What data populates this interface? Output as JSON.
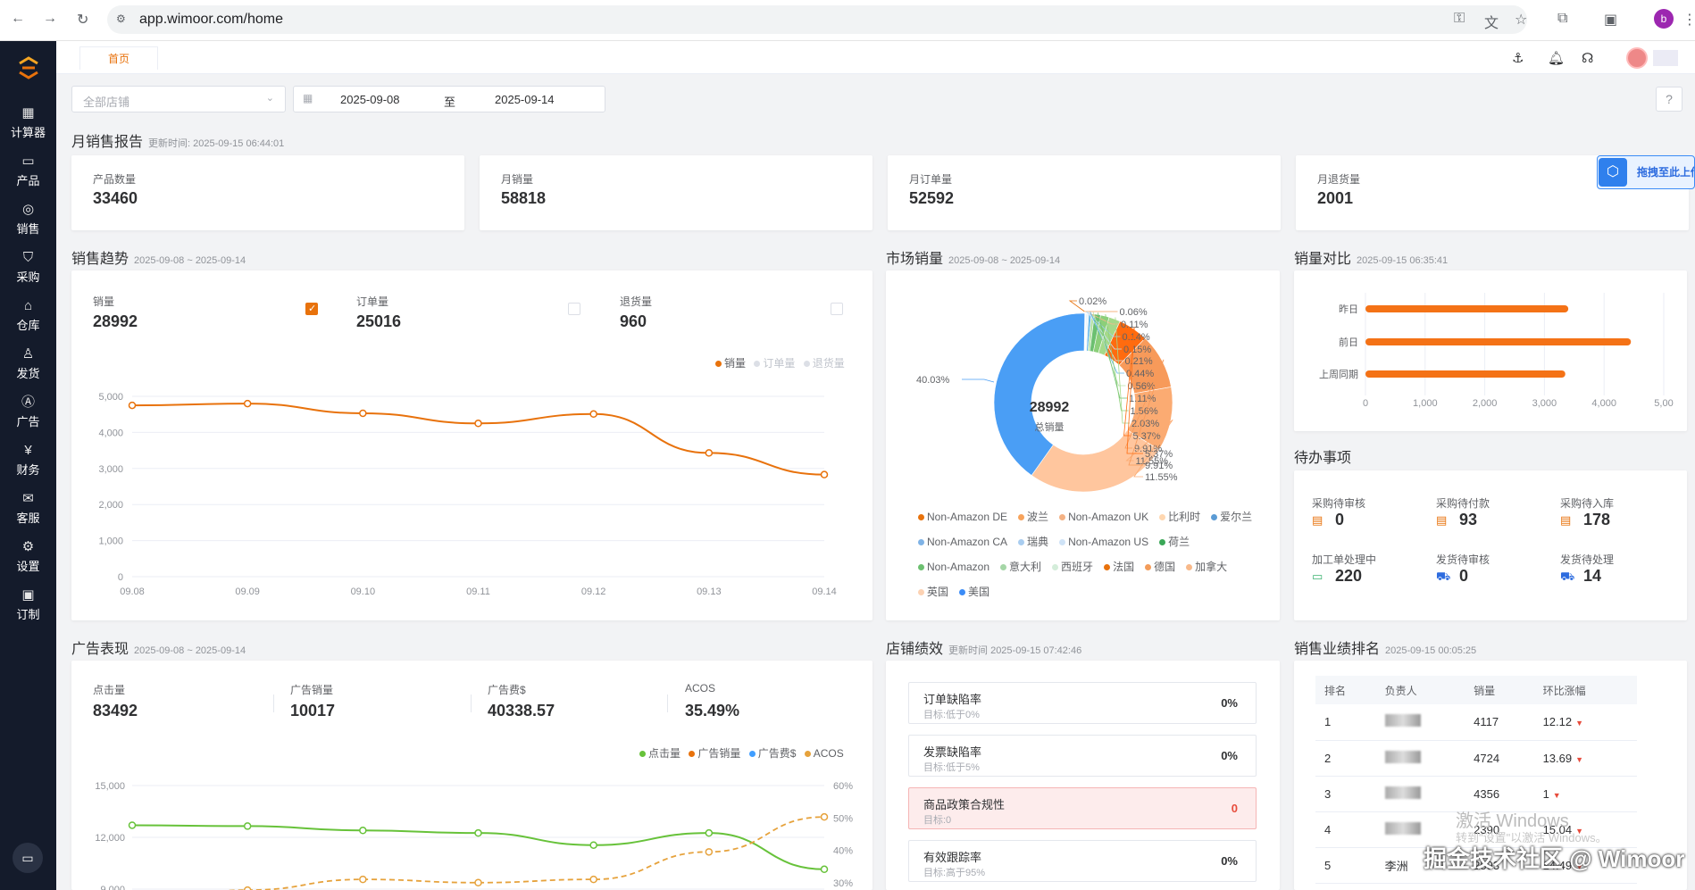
{
  "browser": {
    "url": "app.wimoor.com/home",
    "profile": "b"
  },
  "sidebar": {
    "items": [
      {
        "label": "计算器",
        "icon": "calculator-icon",
        "glyph": "▦"
      },
      {
        "label": "产品",
        "icon": "box-icon",
        "glyph": "▭"
      },
      {
        "label": "销售",
        "icon": "sales-icon",
        "glyph": "◎"
      },
      {
        "label": "采购",
        "icon": "bag-icon",
        "glyph": "⛉"
      },
      {
        "label": "仓库",
        "icon": "warehouse-icon",
        "glyph": "⌂"
      },
      {
        "label": "发货",
        "icon": "ship-icon",
        "glyph": "♙"
      },
      {
        "label": "广告",
        "icon": "ad-icon",
        "glyph": "Ⓐ"
      },
      {
        "label": "财务",
        "icon": "finance-icon",
        "glyph": "¥"
      },
      {
        "label": "客服",
        "icon": "mail-icon",
        "glyph": "✉"
      },
      {
        "label": "设置",
        "icon": "gear-icon",
        "glyph": "⚙"
      },
      {
        "label": "订制",
        "icon": "custom-icon",
        "glyph": "▣"
      }
    ]
  },
  "tabs": {
    "home": "首页"
  },
  "filters": {
    "shop_placeholder": "全部店铺",
    "date_from": "2025-09-08",
    "date_sep": "至",
    "date_to": "2025-09-14"
  },
  "monthly": {
    "title": "月销售报告",
    "updated": "更新时间: 2025-09-15 06:44:01",
    "cards": [
      {
        "label": "产品数量",
        "value": "33460"
      },
      {
        "label": "月销量",
        "value": "58818"
      },
      {
        "label": "月订单量",
        "value": "52592"
      },
      {
        "label": "月退货量",
        "value": "2001"
      }
    ]
  },
  "drag_btn": "拖拽至此上传",
  "trend": {
    "title": "销售趋势",
    "range": "2025-09-08 ~ 2025-09-14",
    "stats": [
      {
        "label": "销量",
        "value": "28992",
        "checked": true
      },
      {
        "label": "订单量",
        "value": "25016",
        "checked": false
      },
      {
        "label": "退货量",
        "value": "960",
        "checked": false
      }
    ],
    "legend": [
      {
        "name": "销量",
        "color": "#e8720c",
        "active": true
      },
      {
        "name": "订单量",
        "color": "#c0c4cc",
        "active": false
      },
      {
        "name": "退货量",
        "color": "#c0c4cc",
        "active": false
      }
    ]
  },
  "market": {
    "title": "市场销量",
    "range": "2025-09-08 ~ 2025-09-14",
    "center_value": "28992",
    "center_label": "总销量",
    "left_label": "40.03%",
    "overlap_label": "25.70%",
    "legend": [
      {
        "name": "Non-Amazon DE",
        "color": "#e8720c"
      },
      {
        "name": "波兰",
        "color": "#f7a35c"
      },
      {
        "name": "Non-Amazon UK",
        "color": "#f4b183"
      },
      {
        "name": "比利时",
        "color": "#ffd7b0"
      },
      {
        "name": "爱尔兰",
        "color": "#5b9bd5"
      },
      {
        "name": "Non-Amazon CA",
        "color": "#7fb3e6"
      },
      {
        "name": "瑞典",
        "color": "#a9cdf0"
      },
      {
        "name": "Non-Amazon US",
        "color": "#cfe3f7"
      },
      {
        "name": "荷兰",
        "color": "#3aa757"
      },
      {
        "name": "Non-Amazon",
        "color": "#6cc070"
      },
      {
        "name": "意大利",
        "color": "#a5d6a7"
      },
      {
        "name": "西班牙",
        "color": "#d4edda"
      },
      {
        "name": "法国",
        "color": "#e8720c"
      },
      {
        "name": "德国",
        "color": "#f39c5a"
      },
      {
        "name": "加拿大",
        "color": "#f8b98a"
      },
      {
        "name": "英国",
        "color": "#fcd2b3"
      },
      {
        "name": "美国",
        "color": "#3b8cf7"
      }
    ]
  },
  "compare": {
    "title": "销量对比",
    "updated": "2025-09-15 06:35:41"
  },
  "todo": {
    "title": "待办事项",
    "items": [
      {
        "label": "采购待审核",
        "value": "0",
        "icon": "document-icon",
        "glyph": "▤",
        "tone": ""
      },
      {
        "label": "采购待付款",
        "value": "93",
        "icon": "document-icon",
        "glyph": "▤",
        "tone": ""
      },
      {
        "label": "采购待入库",
        "value": "178",
        "icon": "document-icon",
        "glyph": "▤",
        "tone": ""
      },
      {
        "label": "加工单处理中",
        "value": "220",
        "icon": "monitor-icon",
        "glyph": "▭",
        "tone": "g"
      },
      {
        "label": "发货待审核",
        "value": "0",
        "icon": "truck-icon",
        "glyph": "⛟",
        "tone": "b"
      },
      {
        "label": "发货待处理",
        "value": "14",
        "icon": "truck-icon",
        "glyph": "⛟",
        "tone": "b"
      }
    ]
  },
  "ads": {
    "title": "广告表现",
    "range": "2025-09-08 ~ 2025-09-14",
    "stats": [
      {
        "label": "点击量",
        "value": "83492"
      },
      {
        "label": "广告销量",
        "value": "10017"
      },
      {
        "label": "广告费$",
        "value": "40338.57"
      },
      {
        "label": "ACOS",
        "value": "35.49%"
      }
    ],
    "legend": [
      {
        "name": "点击量",
        "color": "#67c23a"
      },
      {
        "name": "广告销量",
        "color": "#e8720c"
      },
      {
        "name": "广告费$",
        "color": "#409eff"
      },
      {
        "name": "ACOS",
        "color": "#e6a23c"
      }
    ]
  },
  "shop": {
    "title": "店铺绩效",
    "updated": "更新时间 2025-09-15 07:42:46",
    "items": [
      {
        "name": "订单缺陷率",
        "target": "目标:低于0%",
        "value": "0%",
        "alert": false
      },
      {
        "name": "发票缺陷率",
        "target": "目标:低于5%",
        "value": "0%",
        "alert": false
      },
      {
        "name": "商品政策合规性",
        "target": "目标:0",
        "value": "0",
        "alert": true
      },
      {
        "name": "有效跟踪率",
        "target": "目标:高于95%",
        "value": "0%",
        "alert": false
      }
    ]
  },
  "rank": {
    "title": "销售业绩排名",
    "updated": "2025-09-15 00:05:25",
    "headers": [
      "排名",
      "负责人",
      "销量",
      "环比涨幅"
    ],
    "rows": [
      {
        "rank": "1",
        "name": "",
        "sales": "4117",
        "mom": "12.12"
      },
      {
        "rank": "2",
        "name": "",
        "sales": "4724",
        "mom": "13.69"
      },
      {
        "rank": "3",
        "name": "",
        "sales": "4356",
        "mom": "1"
      },
      {
        "rank": "4",
        "name": "",
        "sales": "2390",
        "mom": "15.04"
      },
      {
        "rank": "5",
        "name": "李洲",
        "sales": "2593",
        "mom": "14.49"
      }
    ]
  },
  "watermarks": {
    "windows1": "激活 Windows",
    "windows2": "转到\"设置\"以激活 Windows。",
    "juejin": "掘金技术社区 @ Wimoor"
  },
  "chart_data": [
    {
      "type": "line",
      "title": "销售趋势",
      "x": [
        "09.08",
        "09.09",
        "09.10",
        "09.11",
        "09.12",
        "09.13",
        "09.14"
      ],
      "series": [
        {
          "name": "销量",
          "values": [
            4750,
            4800,
            4530,
            4250,
            4510,
            3430,
            2830
          ]
        }
      ],
      "ylim": [
        0,
        5000
      ],
      "yticks": [
        0,
        1000,
        2000,
        3000,
        4000,
        5000
      ],
      "ytick_labels": [
        "0",
        "1,000",
        "2,000",
        "3,000",
        "4,000",
        "5,000"
      ],
      "grid": true,
      "legend": "top-right"
    },
    {
      "type": "pie",
      "title": "市场销量",
      "slices": [
        {
          "label": "40.03%",
          "value": 40.03,
          "color": "#4a9ef5"
        },
        {
          "label": "25.70%",
          "value": 25.7,
          "color": "#ffc69e"
        },
        {
          "label": "11.55%",
          "value": 11.55,
          "color": "#fbab72"
        },
        {
          "label": "9.91%",
          "value": 9.91,
          "color": "#f79a5a"
        },
        {
          "label": "5.37%",
          "value": 5.37,
          "color": "#ff6b0f"
        },
        {
          "label": "2.03%",
          "value": 2.03,
          "color": "#a5d98a"
        },
        {
          "label": "1.56%",
          "value": 1.56,
          "color": "#8ccf7a"
        },
        {
          "label": "1.11%",
          "value": 1.11,
          "color": "#6cc070"
        },
        {
          "label": "0.56%",
          "value": 0.56,
          "color": "#b7e1a8"
        },
        {
          "label": "0.44%",
          "value": 0.44,
          "color": "#5fb3e6"
        },
        {
          "label": "0.21%",
          "value": 0.21,
          "color": "#d3e9f7"
        },
        {
          "label": "0.15%",
          "value": 0.15,
          "color": "#c6e2f6"
        },
        {
          "label": "0.14%",
          "value": 0.14,
          "color": "#9fd0f2"
        },
        {
          "label": "0.11%",
          "value": 0.11,
          "color": "#f8b98a"
        },
        {
          "label": "0.06%",
          "value": 0.06,
          "color": "#f39c5a"
        },
        {
          "label": "0.02%",
          "value": 0.02,
          "color": "#e8720c"
        },
        {
          "label": "0.02%",
          "value": 0.02,
          "color": "#3b8cf7"
        }
      ]
    },
    {
      "type": "bar",
      "title": "销量对比",
      "orientation": "horizontal",
      "categories": [
        "昨日",
        "前日",
        "上周同期"
      ],
      "values": [
        3400,
        4450,
        3350
      ],
      "xlim": [
        0,
        5000
      ],
      "xticks": [
        0,
        1000,
        2000,
        3000,
        4000,
        5000
      ],
      "xtick_labels": [
        "0",
        "1,000",
        "2,000",
        "3,000",
        "4,000",
        "5,00"
      ]
    },
    {
      "type": "line",
      "title": "广告表现",
      "x": [
        "09.08",
        "09.09",
        "09.10",
        "09.11",
        "09.12",
        "09.13",
        "09.14"
      ],
      "series": [
        {
          "name": "点击量",
          "axis": "left",
          "values": [
            12700,
            12650,
            12400,
            12250,
            11550,
            12250,
            10150
          ]
        },
        {
          "name": "ACOS",
          "axis": "right",
          "values": [
            23.5,
            27.7,
            31,
            30,
            31,
            39.5,
            50.3
          ]
        }
      ],
      "ylim": [
        7500,
        15000
      ],
      "yticks": [
        9000,
        12000,
        15000
      ],
      "ytick_labels": [
        "9,000",
        "12,000",
        "15,000"
      ],
      "y2lim": [
        20,
        60
      ],
      "y2ticks": [
        30,
        40,
        50,
        60
      ],
      "y2tick_labels": [
        "30%",
        "40%",
        "50%",
        "60%"
      ]
    }
  ]
}
